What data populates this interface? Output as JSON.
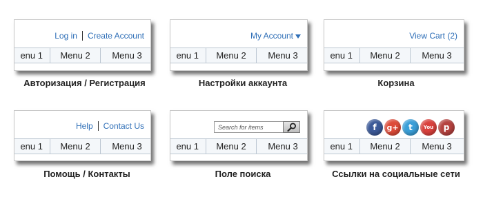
{
  "colors": {
    "link": "#2f6fb7",
    "facebook": "#3b5998",
    "googleplus": "#dd4b39",
    "twitter": "#3a9fd8",
    "youtube": "#d9413d",
    "pinterest": "#cb2027"
  },
  "menu": {
    "item1": "enu 1",
    "item2": "Menu 2",
    "item3": "Menu 3"
  },
  "auth": {
    "login": "Log in",
    "create": "Create Account",
    "caption": "Авторизация / Регистрация"
  },
  "account": {
    "label": "My Account",
    "icon": "triangle-down-icon",
    "caption": "Настройки аккаунта"
  },
  "cart": {
    "label": "View Cart (2)",
    "caption": "Корзина"
  },
  "help": {
    "help": "Help",
    "contact": "Contact Us",
    "caption": "Помощь / Контакты"
  },
  "search": {
    "placeholder": "Search for items",
    "icon": "magnifier-icon",
    "caption": "Поле поиска"
  },
  "social": {
    "caption": "Ссылки на социальные сети",
    "icons": [
      {
        "name": "facebook-icon",
        "glyph": "f"
      },
      {
        "name": "googleplus-icon",
        "glyph": "g+"
      },
      {
        "name": "twitter-icon",
        "glyph": "t"
      },
      {
        "name": "youtube-icon",
        "glyph": "You"
      },
      {
        "name": "pinterest-icon",
        "glyph": "p"
      }
    ]
  }
}
